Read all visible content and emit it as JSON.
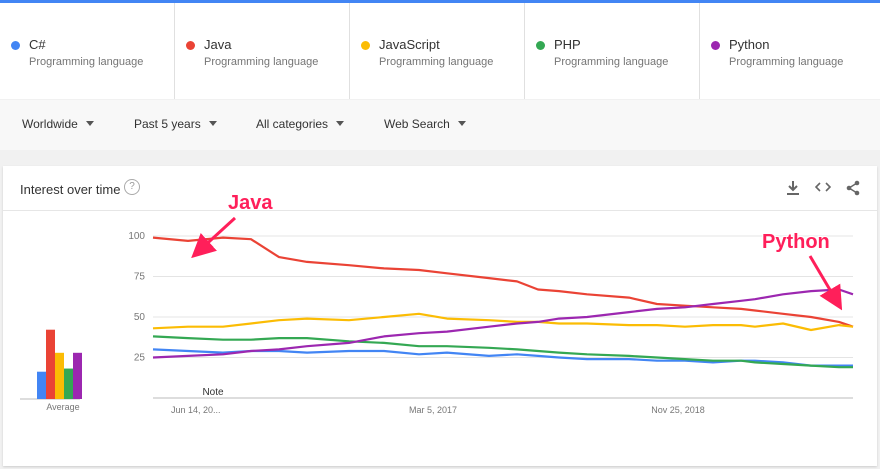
{
  "terms": [
    {
      "name": "C#",
      "sub": "Programming language",
      "color": "#4285f4"
    },
    {
      "name": "Java",
      "sub": "Programming language",
      "color": "#ea4335"
    },
    {
      "name": "JavaScript",
      "sub": "Programming language",
      "color": "#fbbc04"
    },
    {
      "name": "PHP",
      "sub": "Programming language",
      "color": "#34a853"
    },
    {
      "name": "Python",
      "sub": "Programming language",
      "color": "#9c27b0"
    }
  ],
  "filters": {
    "region": "Worldwide",
    "time": "Past 5 years",
    "category": "All categories",
    "search_type": "Web Search"
  },
  "card": {
    "title": "Interest over time",
    "help_icon": "?",
    "download_icon": "download-icon",
    "embed_icon": "embed-icon",
    "share_icon": "share-icon"
  },
  "annotations": {
    "java": "Java",
    "python": "Python"
  },
  "chart_data": [
    {
      "type": "bar",
      "title": "",
      "xlabel": "Average",
      "categories": [
        "C#",
        "Java",
        "JavaScript",
        "PHP",
        "Python"
      ],
      "values": [
        26,
        66,
        44,
        29,
        44
      ],
      "ylim": [
        0,
        100
      ]
    },
    {
      "type": "line",
      "title": "",
      "x_tick_labels": [
        "Jun 14, 20...",
        "Mar 5, 2017",
        "Nov 25, 2018"
      ],
      "y_ticks": [
        25,
        50,
        75,
        100
      ],
      "ylim": [
        0,
        100
      ],
      "grid": true,
      "note_label": "Note",
      "x": [
        0,
        0.05,
        0.1,
        0.14,
        0.18,
        0.22,
        0.28,
        0.33,
        0.38,
        0.42,
        0.48,
        0.52,
        0.55,
        0.58,
        0.62,
        0.68,
        0.72,
        0.76,
        0.8,
        0.84,
        0.86,
        0.9,
        0.94,
        0.98,
        1
      ],
      "series": [
        {
          "name": "C#",
          "color": "#4285f4",
          "values": [
            30,
            29,
            28,
            29,
            29,
            28,
            29,
            29,
            27,
            28,
            26,
            27,
            26,
            25,
            24,
            24,
            23,
            23,
            22,
            23,
            23,
            22,
            20,
            20,
            20
          ]
        },
        {
          "name": "Java",
          "color": "#ea4335",
          "values": [
            99,
            97,
            99,
            98,
            87,
            84,
            82,
            80,
            79,
            77,
            74,
            72,
            67,
            66,
            64,
            62,
            58,
            57,
            56,
            55,
            54,
            52,
            50,
            47,
            44
          ]
        },
        {
          "name": "JavaScript",
          "color": "#fbbc04",
          "values": [
            43,
            44,
            44,
            46,
            48,
            49,
            48,
            50,
            52,
            49,
            48,
            47,
            47,
            46,
            46,
            45,
            45,
            44,
            45,
            45,
            44,
            46,
            42,
            45,
            44
          ]
        },
        {
          "name": "PHP",
          "color": "#34a853",
          "values": [
            38,
            37,
            36,
            36,
            37,
            37,
            35,
            34,
            32,
            32,
            31,
            30,
            29,
            28,
            27,
            26,
            25,
            24,
            23,
            23,
            22,
            21,
            20,
            19,
            19
          ]
        },
        {
          "name": "Python",
          "color": "#9c27b0",
          "values": [
            25,
            26,
            27,
            29,
            30,
            32,
            34,
            38,
            40,
            41,
            44,
            46,
            47,
            49,
            50,
            53,
            55,
            56,
            58,
            60,
            61,
            64,
            66,
            67,
            64
          ]
        }
      ]
    }
  ]
}
